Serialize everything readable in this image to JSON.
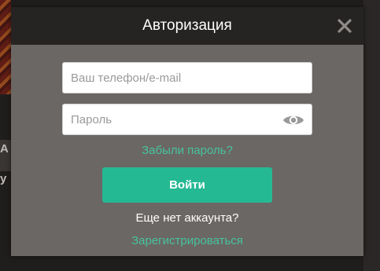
{
  "background": {
    "fragments": [
      "А",
      "у"
    ]
  },
  "modal": {
    "title": "Авторизация",
    "close_icon": "close-icon",
    "login_field": {
      "value": "",
      "placeholder": "Ваш телефон/e-mail"
    },
    "password_field": {
      "value": "",
      "placeholder": "Пароль",
      "toggle_icon": "eye-icon"
    },
    "forgot_password_label": "Забыли пароль?",
    "login_button_label": "Войти",
    "no_account_text": "Еще нет аккаунта?",
    "register_label": "Зарегистрироваться"
  },
  "colors": {
    "accent": "#25b993",
    "link": "#46c39f",
    "modal_body": "#6b6764",
    "modal_header": "#262423"
  }
}
